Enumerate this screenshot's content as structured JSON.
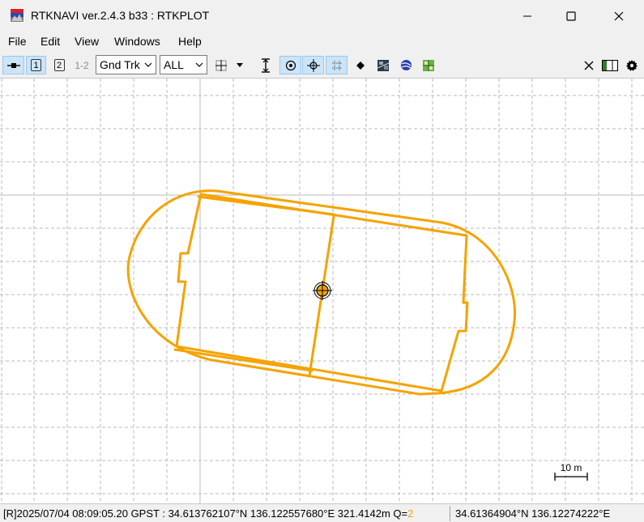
{
  "window": {
    "title": "RTKNAVI ver.2.4.3 b33 : RTKPLOT"
  },
  "menu": {
    "items": [
      {
        "label": "File"
      },
      {
        "label": "Edit"
      },
      {
        "label": "View"
      },
      {
        "label": "Windows"
      },
      {
        "label": "Help"
      }
    ]
  },
  "toolbar": {
    "solution_1_label": "1",
    "solution_2_label": "2",
    "solution_12_label": "1-2",
    "plot_type": "Gnd Trk",
    "quality_filter": "ALL"
  },
  "plot": {
    "scale_label": "10 m",
    "track_color": "#f4a300",
    "grid_color": "#b0b0b0",
    "axis_color": "#c8c8c8"
  },
  "status": {
    "left": "[R]2025/07/04 08:09:05.20 GPST :  34.613762107°N  136.122557680°E  321.4142m  Q=",
    "q": "2",
    "right": "34.61364904°N  136.12274222°E"
  }
}
